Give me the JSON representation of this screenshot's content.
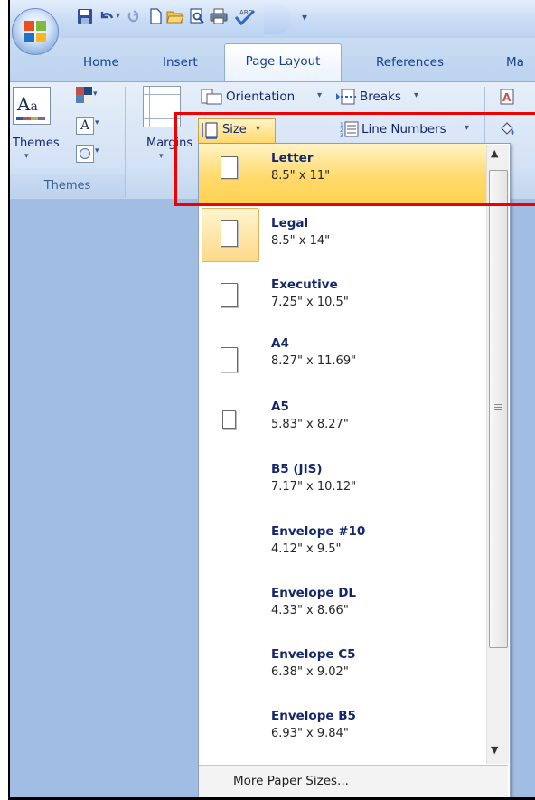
{
  "tabs": [
    "Home",
    "Insert",
    "Page Layout",
    "References",
    "Ma"
  ],
  "ribbon": {
    "themes_label": "Themes",
    "group_themes": "Themes",
    "margins_label": "Margins",
    "orientation": "Orientation",
    "breaks": "Breaks",
    "size": "Size",
    "line_numbers": "Line Numbers"
  },
  "sizes": [
    {
      "name": "Letter",
      "dims": "8.5\" x 11\""
    },
    {
      "name": "Legal",
      "dims": "8.5\" x 14\""
    },
    {
      "name": "Executive",
      "dims": "7.25\" x 10.5\""
    },
    {
      "name": "A4",
      "dims": "8.27\" x 11.69\""
    },
    {
      "name": "A5",
      "dims": "5.83\" x 8.27\""
    },
    {
      "name": "B5 (JIS)",
      "dims": "7.17\" x 10.12\""
    },
    {
      "name": "Envelope #10",
      "dims": "4.12\" x 9.5\""
    },
    {
      "name": "Envelope DL",
      "dims": "4.33\" x 8.66\""
    },
    {
      "name": "Envelope C5",
      "dims": "6.38\" x 9.02\""
    },
    {
      "name": "Envelope B5",
      "dims": "6.93\" x 9.84\""
    }
  ],
  "more_sizes_prefix": "More P",
  "more_sizes_underline": "a",
  "more_sizes_suffix": "per Sizes...",
  "colors": {
    "highlight": "#ee0000",
    "selected": "#ffd96c",
    "tab_text": "#15428b"
  }
}
